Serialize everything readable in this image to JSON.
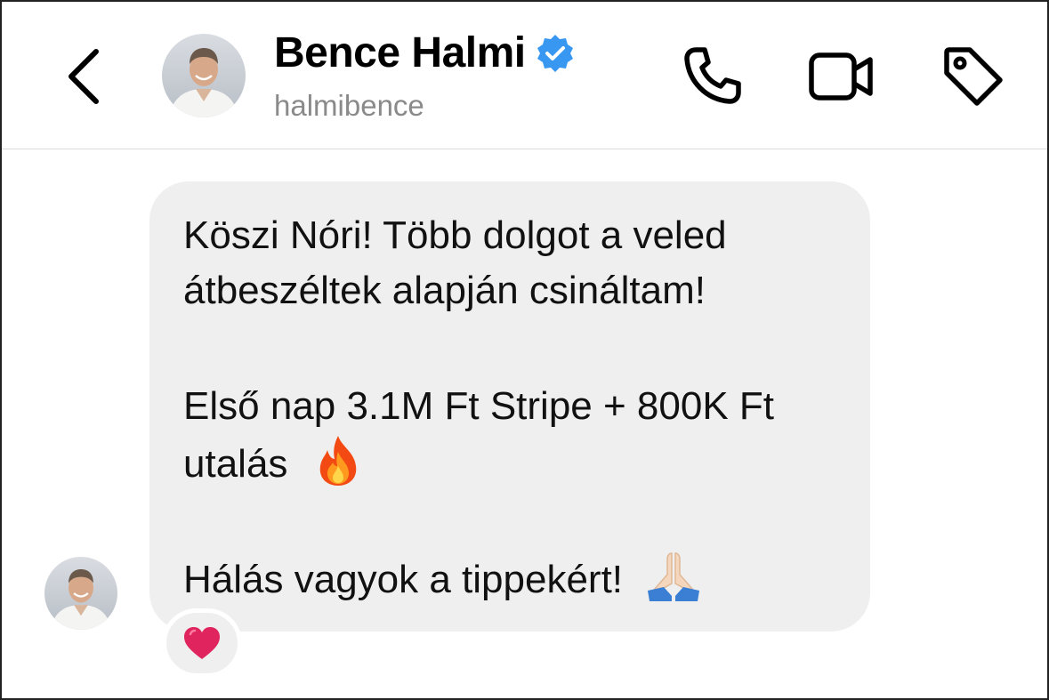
{
  "header": {
    "name": "Bence Halmi",
    "username": "halmibence",
    "verified": true,
    "icons": [
      "back-chevron-icon",
      "phone-icon",
      "video-icon",
      "tag-icon"
    ]
  },
  "message": {
    "lines": [
      "Köszi Nóri! Több dolgot a veled",
      "átbeszéltek alapján csináltam!",
      "Első nap 3.1M Ft Stripe + 800K Ft",
      "utalás",
      "Hálás vagyok a tippekért!"
    ],
    "emojis": [
      "fire-emoji",
      "folded-hands-emoji"
    ],
    "reaction": "red-heart-emoji"
  },
  "colors": {
    "bubble": "#efefef",
    "verified": "#3897f0",
    "username": "#8a8a8a",
    "heart": "#e0245e"
  }
}
